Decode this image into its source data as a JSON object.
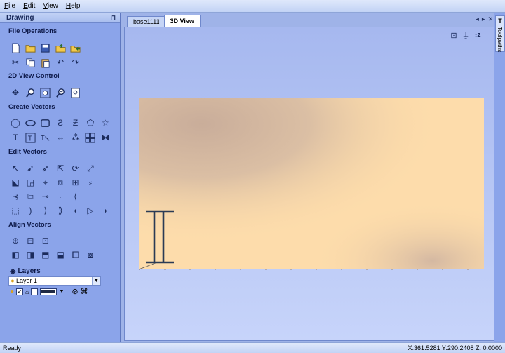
{
  "menu": [
    "File",
    "Edit",
    "View",
    "Help"
  ],
  "panel": {
    "title": "Drawing",
    "pin_icon": "pin-icon",
    "sections": {
      "file_operations": "File Operations",
      "view_control": "2D View Control",
      "create_vectors": "Create Vectors",
      "edit_vectors": "Edit Vectors",
      "align_vectors": "Align Vectors"
    },
    "layers": {
      "title": "Layers",
      "current": "Layer 1",
      "color": "#1f2a45"
    }
  },
  "tabs": [
    {
      "label": "base1111",
      "active": false
    },
    {
      "label": "3D View",
      "active": true
    }
  ],
  "side_tab": "Toolpaths",
  "status": {
    "left": "Ready",
    "coords": "X:361.5281 Y:290.2408 Z:  0.0000"
  },
  "colors": {
    "panel": "#8ba4ea",
    "wood": "#fddcab",
    "wood_shadow": "#d4b8a2",
    "ibeam": "#2b3b55"
  }
}
